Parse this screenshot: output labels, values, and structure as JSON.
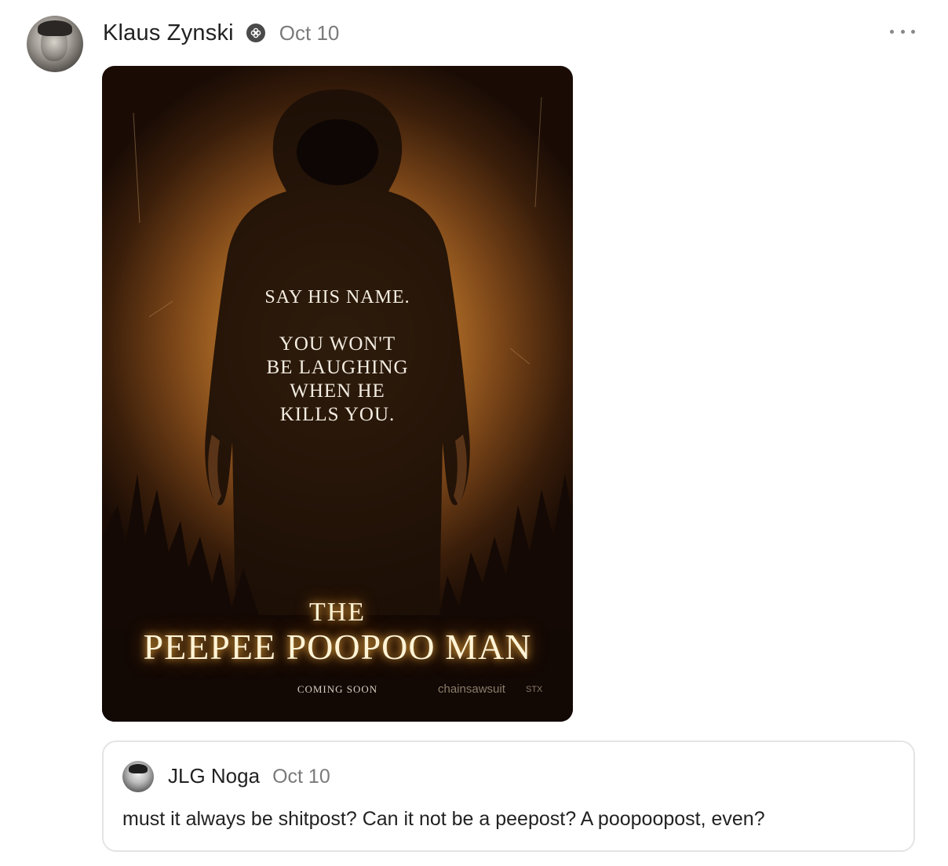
{
  "post": {
    "author": "Klaus Zynski",
    "date": "Oct 10",
    "badge_icon": "subscriber-badge-icon",
    "more_icon": "more-options-icon",
    "image": {
      "tagline": "SAY HIS NAME.",
      "tagline2": [
        "YOU WON'T",
        "BE LAUGHING",
        "WHEN HE",
        "KILLS YOU."
      ],
      "title_small": "THE",
      "title_big": "PEEPEE POOPOO MAN",
      "coming_soon": "COMING SOON",
      "logo_right": "chainsawsuit",
      "logo_right2": "STX"
    }
  },
  "reply": {
    "author": "JLG Noga",
    "date": "Oct 10",
    "body": "must it always be shitpost? Can it not be a peepost? A poopoopost, even?"
  }
}
